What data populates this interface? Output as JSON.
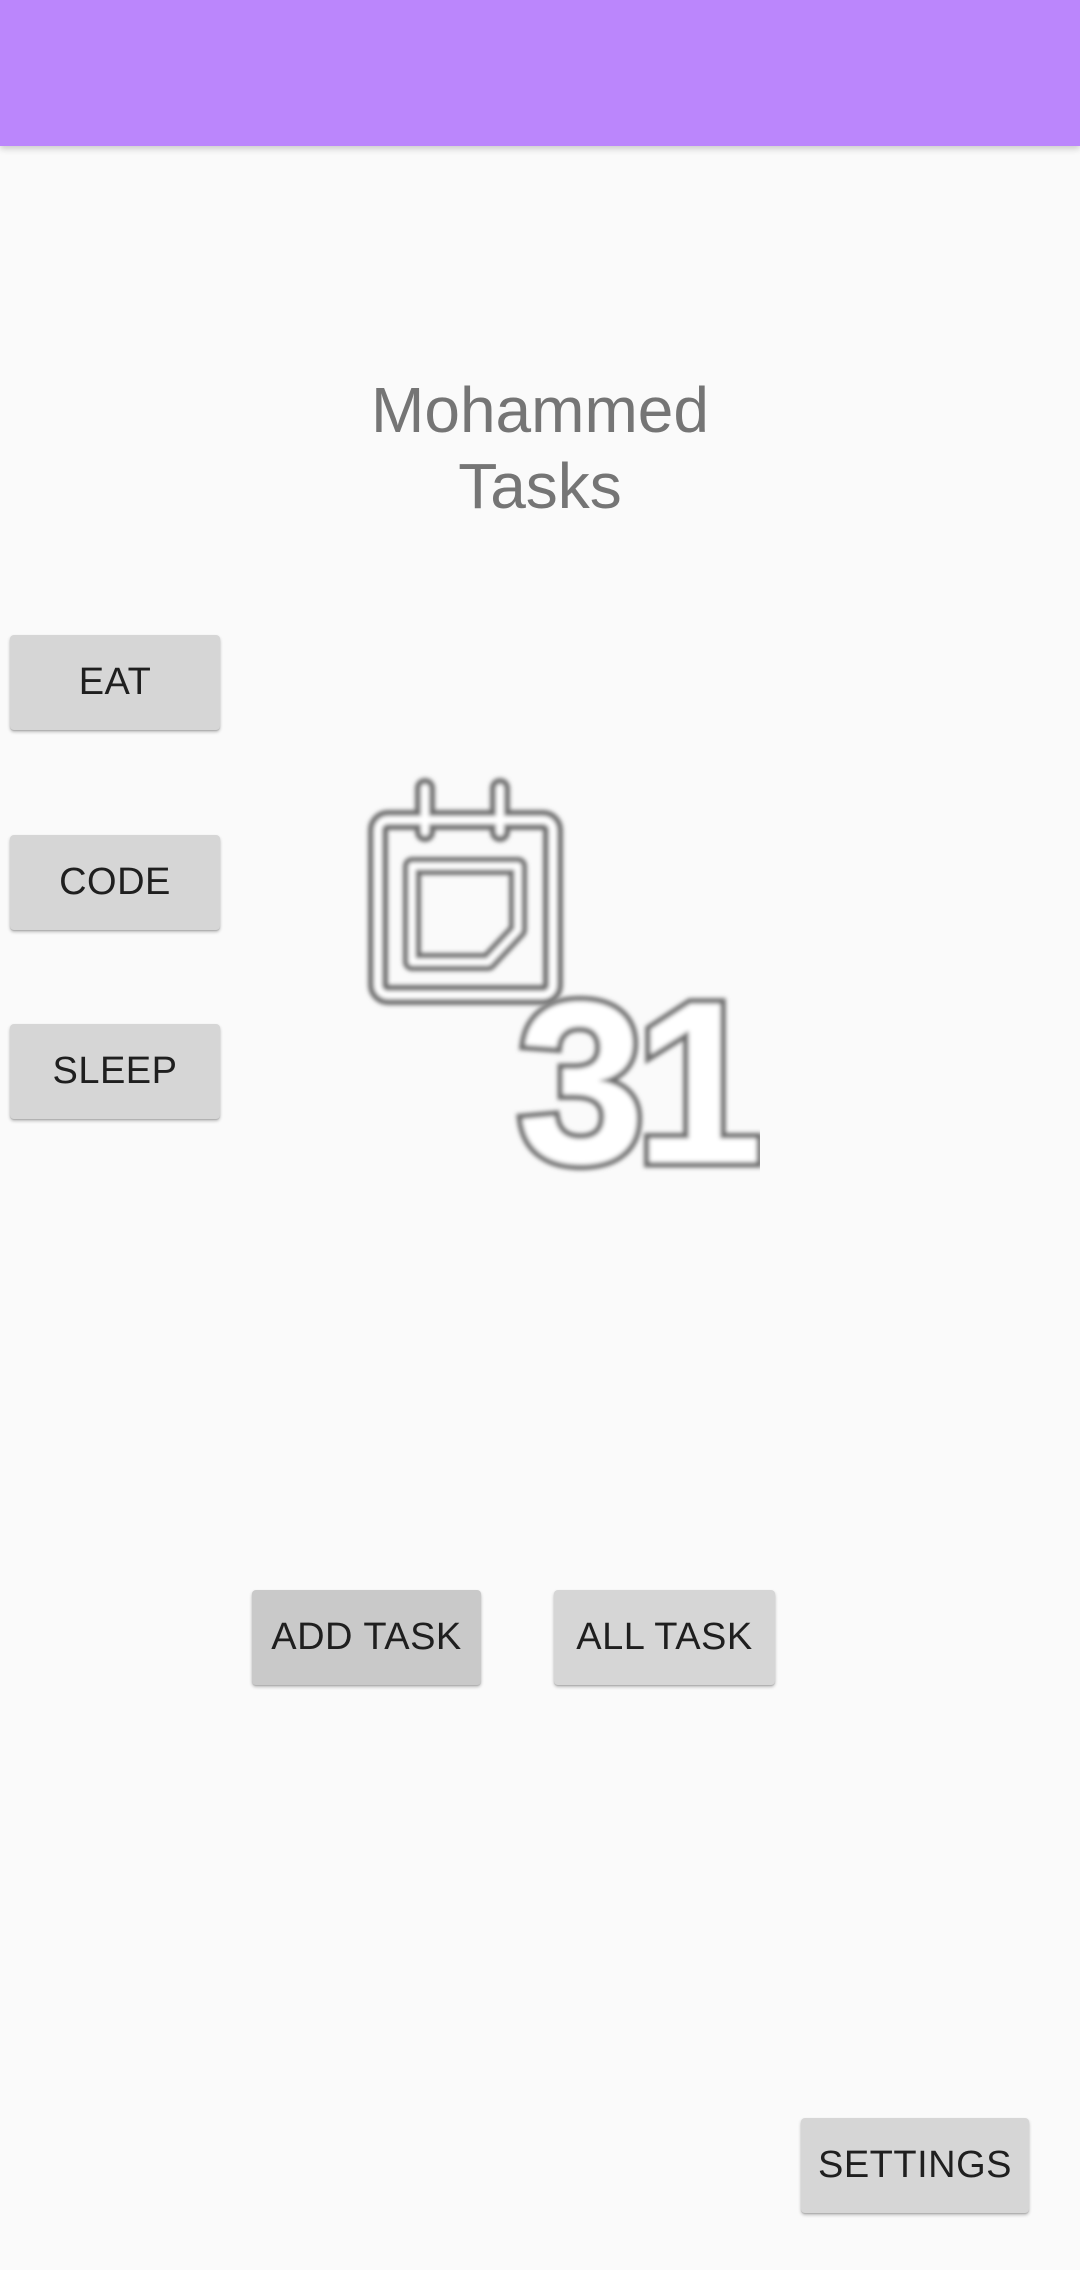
{
  "header": {
    "color": "#bb86fc"
  },
  "main": {
    "title_line1": "Mohammed",
    "title_line2": "Tasks",
    "icon": "calendar-31-icon",
    "icon_text": "31"
  },
  "quick_buttons": {
    "eat": "EAT",
    "code": "CODE",
    "sleep": "SLEEP"
  },
  "actions": {
    "add_task": "ADD TASK",
    "all_task": "ALL TASK",
    "settings": "SETTINGS"
  }
}
